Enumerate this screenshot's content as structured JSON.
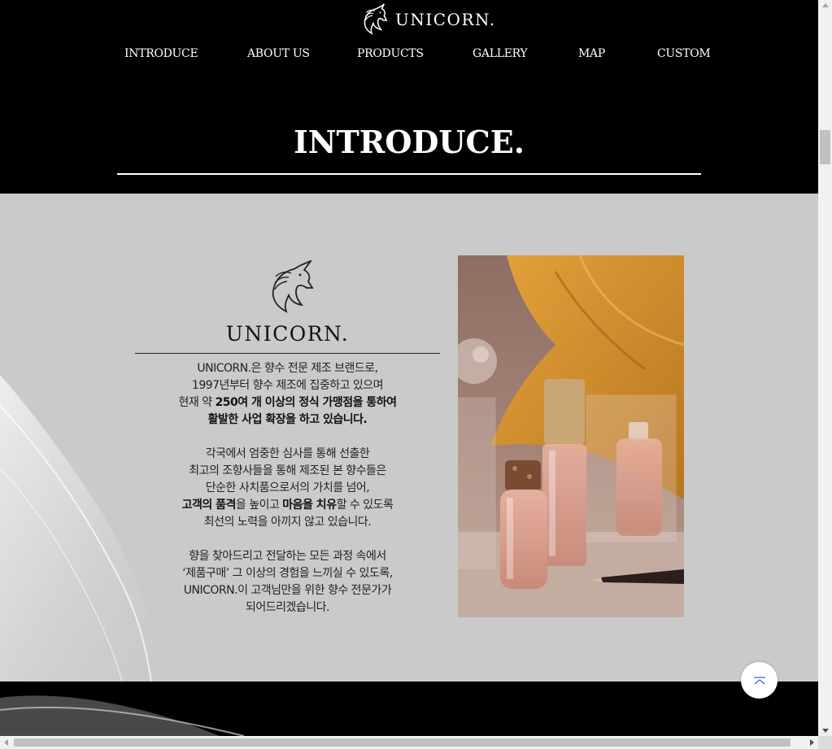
{
  "header": {
    "logo_text": "UNICORN.",
    "logo_icon": "unicorn-head-icon"
  },
  "nav": {
    "items": [
      "INTRODUCE",
      "ABOUT US",
      "PRODUCTS",
      "GALLERY",
      "MAP",
      "CUSTOM"
    ]
  },
  "section": {
    "title": "INTRODUCE."
  },
  "intro": {
    "brand_name": "UNICORN.",
    "p1": {
      "l1": "UNICORN.은 향수 전문 제조 브랜드로,",
      "l2": "1997년부터 향수 제조에 집중하고 있으며",
      "l3_pre": "현재 약 ",
      "l3_bold": "250여 개 이상의 정식 가맹점을 통하여",
      "l4_bold": "활발한 사업 확장을 하고 있습니다."
    },
    "p2": {
      "l1": "각국에서 엄중한 심사를 통해 선출한",
      "l2": "최고의 조향사들을 통해 제조된 본 향수들은",
      "l3": "단순한 사치품으로서의 가치를 넘어,",
      "l4_bold1": "고객의 품격",
      "l4_mid": "을 높이고 ",
      "l4_bold2": "마음을 치유",
      "l4_post": "할 수 있도록",
      "l5": "최선의 노력을 아끼지 않고 있습니다."
    },
    "p3": {
      "l1": "향을 찾아드리고 전달하는 모든 과정 속에서",
      "l2": "‘제품구매’ 그 이상의 경험을 느끼실 수 있도록,",
      "l3": "UNICORN.이 고객님만을 위한 향수 전문가가",
      "l4": "되어드리겠습니다."
    },
    "photo_icon": "perfume-bottles-photo"
  },
  "colors": {
    "header_bg": "#000000",
    "band_bg": "#cacaca",
    "text": "#222222",
    "accent_orange": "#d9952a"
  },
  "controls": {
    "top_button_icon": "scroll-to-top-icon"
  }
}
